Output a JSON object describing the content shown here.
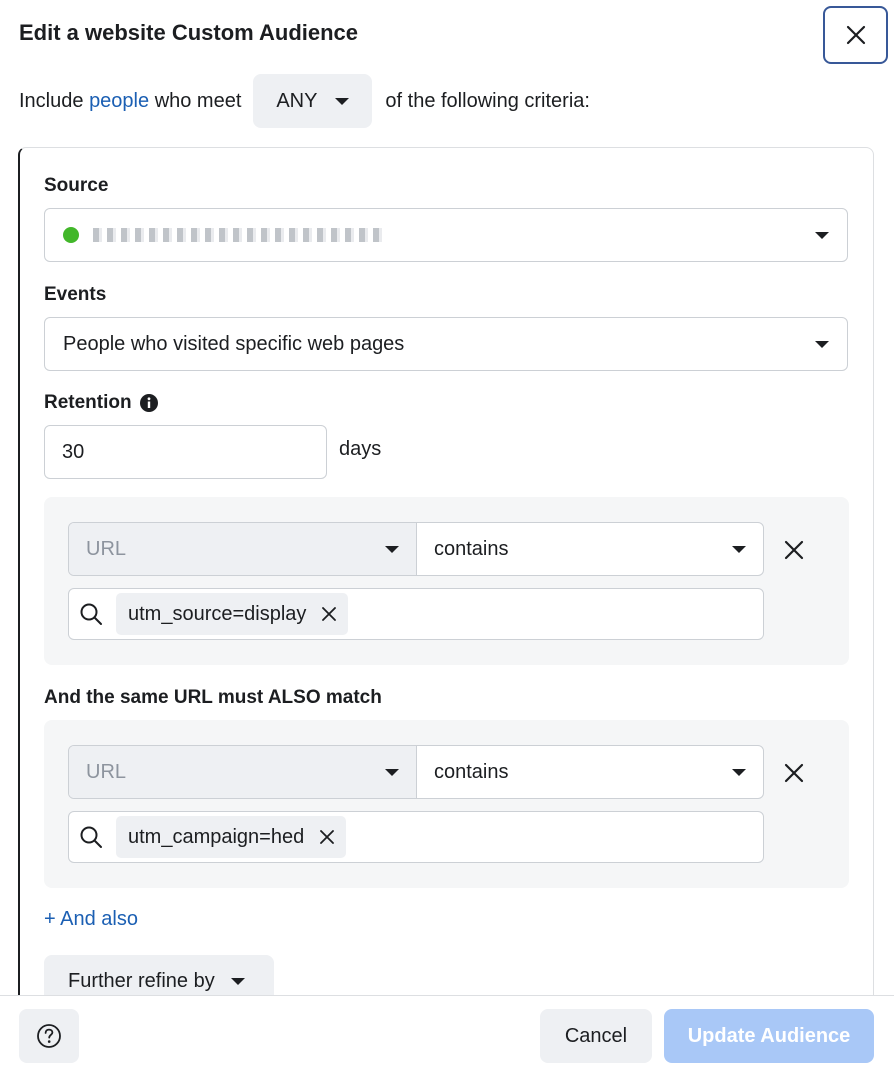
{
  "dialog": {
    "title": "Edit a website Custom Audience"
  },
  "include": {
    "prefix": "Include",
    "link": "people",
    "middle": "who meet",
    "match_type": "ANY",
    "suffix": "of the following criteria:"
  },
  "source": {
    "label": "Source",
    "status_color": "#42b72a"
  },
  "events": {
    "label": "Events",
    "value": "People who visited specific web pages"
  },
  "retention": {
    "label": "Retention",
    "value": "30",
    "unit": "days"
  },
  "rules": [
    {
      "field": "URL",
      "operator": "contains",
      "token": "utm_source=display"
    },
    {
      "field": "URL",
      "operator": "contains",
      "token": "utm_campaign=hed"
    }
  ],
  "also_match_label": "And the same URL must ALSO match",
  "and_also_link": "+ And also",
  "refine_label": "Further refine by",
  "footer": {
    "cancel": "Cancel",
    "update": "Update Audience"
  },
  "colors": {
    "link": "#1b5fb3",
    "primary_disabled": "#a9c8f7",
    "focus_border": "#385898"
  }
}
